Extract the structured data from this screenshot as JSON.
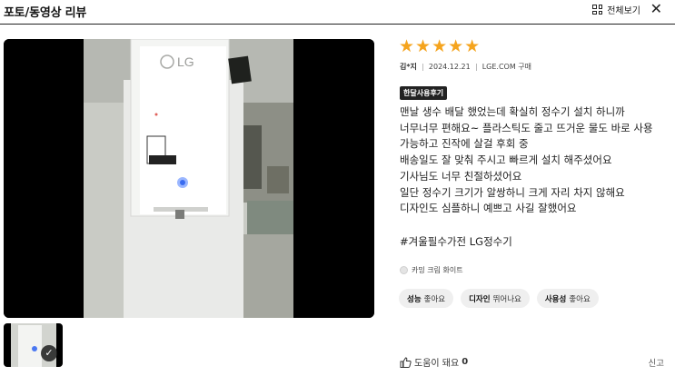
{
  "header": {
    "title": "포토/동영상 리뷰",
    "view_all_label": "전체보기",
    "close_icon": "close-icon",
    "grid_icon": "grid-icon"
  },
  "review": {
    "rating": 5,
    "stars": "★★★★★",
    "reviewer": "김*지",
    "date": "2024.12.21",
    "purchase_source": "LGE.COM 구매",
    "badge": "한달사용후기",
    "body": "맨날 생수 배달 했었는데 확실히 정수기 설치 하니까\n너무너무 편해요~ 플라스틱도 줄고 뜨거운 물도 바로 사용\n가능하고 진작에 살걸 후회 중\n배송일도 잘 맞춰 주시고 빠르게 설치 해주셨어요\n기사님도 너무 친절하셨어요\n일단 정수기 크기가 알쌍하니 크게 자리 차지 않해요\n디자인도 심플하니 예쁘고 사길 잘했어요",
    "hashtag": "#겨울필수가전 LG정수기",
    "option": "카밍 크림 화이트",
    "chips": [
      {
        "key": "성능",
        "value": "좋아요"
      },
      {
        "key": "디자인",
        "value": "뛰어나요"
      },
      {
        "key": "사용성",
        "value": "좋아요"
      }
    ],
    "helpful_label": "도움이 돼요",
    "helpful_count": "0",
    "report_label": "신고"
  },
  "photo": {
    "brand_text": "LG",
    "thumbnail_selected": true
  },
  "colors": {
    "star": "#f5a41e",
    "badge_bg": "#222222",
    "chip_bg": "#efefef"
  }
}
